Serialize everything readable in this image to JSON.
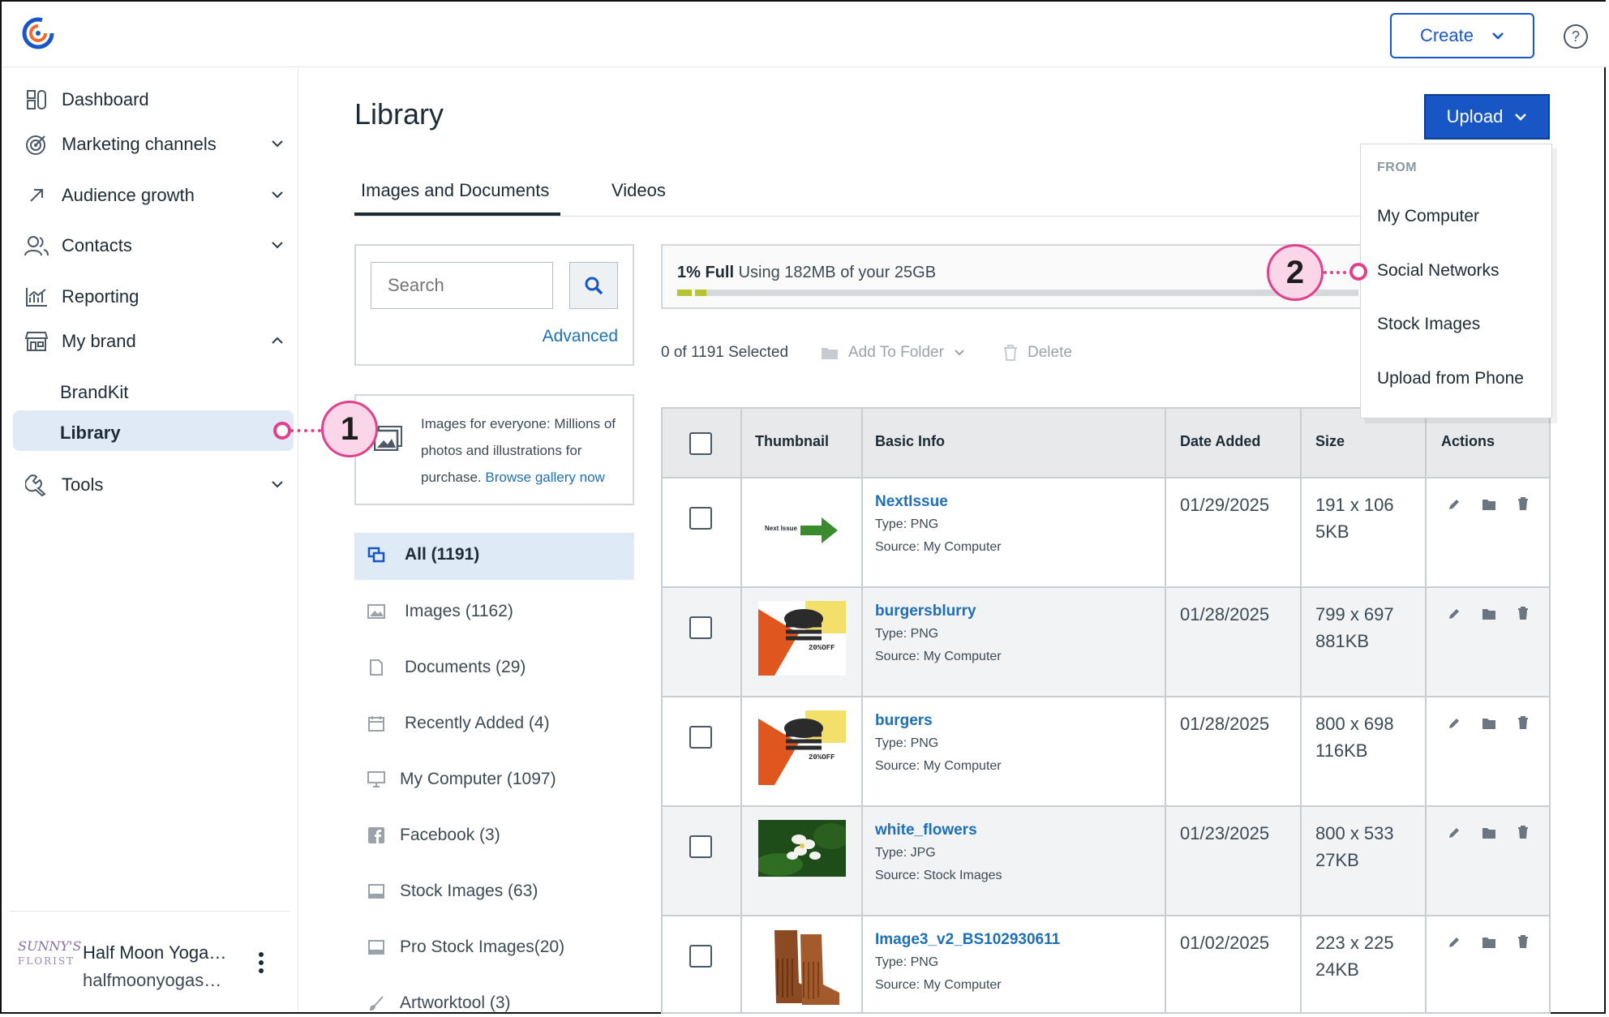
{
  "header": {
    "create_label": "Create",
    "help_glyph": "?"
  },
  "sidebar": {
    "items": [
      {
        "label": "Dashboard",
        "icon": "dashboard-icon"
      },
      {
        "label": "Marketing channels",
        "icon": "target-icon"
      },
      {
        "label": "Audience growth",
        "icon": "arrow-up-right-icon"
      },
      {
        "label": "Contacts",
        "icon": "contacts-icon"
      },
      {
        "label": "Reporting",
        "icon": "chart-icon"
      },
      {
        "label": "My brand",
        "icon": "store-icon"
      },
      {
        "label": "Tools",
        "icon": "wrench-icon"
      }
    ],
    "sub_items": [
      "BrandKit",
      "Library"
    ],
    "account": {
      "name": "Half Moon Yoga…",
      "email": "halfmoonyogas…",
      "logo_line1": "SUNNY'S",
      "logo_line2": "FLORIST"
    }
  },
  "main": {
    "title": "Library",
    "upload_label": "Upload",
    "tabs": [
      "Images and Documents",
      "Videos"
    ],
    "search": {
      "placeholder": "Search",
      "advanced_label": "Advanced"
    },
    "promo": {
      "text": "Images for everyone: Millions of photos and illustrations for purchase.",
      "link": "Browse gallery now"
    },
    "filters": [
      "All (1191)",
      "Images (1162)",
      "Documents (29)",
      "Recently Added (4)",
      "My Computer (1097)",
      "Facebook (3)",
      "Stock Images (63)",
      "Pro Stock Images(20)",
      "Artworktool (3)"
    ],
    "storage": {
      "percent_label": "1% Full",
      "usage_text": "Using 182MB of your 25GB",
      "fill_fraction": 0.01
    },
    "toolbar": {
      "selected": "0 of 1191 Selected",
      "add_to_folder": "Add To Folder",
      "delete": "Delete"
    },
    "table": {
      "headers": [
        "Thumbnail",
        "Basic Info",
        "Date Added",
        "Size",
        "Actions"
      ],
      "rows": [
        {
          "name": "NextIssue",
          "type": "Type: PNG",
          "source": "Source: My Computer",
          "date": "01/29/2025",
          "dims": "191 x 106",
          "size": "5KB",
          "thumb_text": "Next Issue"
        },
        {
          "name": "burgersblurry",
          "type": "Type: PNG",
          "source": "Source: My Computer",
          "date": "01/28/2025",
          "dims": "799 x 697",
          "size": "881KB",
          "thumb_text": "20%OFF"
        },
        {
          "name": "burgers",
          "type": "Type: PNG",
          "source": "Source: My Computer",
          "date": "01/28/2025",
          "dims": "800 x 698",
          "size": "116KB",
          "thumb_text": "20%OFF"
        },
        {
          "name": "white_flowers",
          "type": "Type: JPG",
          "source": "Source: Stock Images",
          "date": "01/23/2025",
          "dims": "800 x 533",
          "size": "27KB",
          "thumb_text": ""
        },
        {
          "name": "Image3_v2_BS102930611",
          "type": "Type: PNG",
          "source": "Source: My Computer",
          "date": "01/02/2025",
          "dims": "223 x 225",
          "size": "24KB",
          "thumb_text": ""
        }
      ]
    },
    "upload_menu": {
      "heading": "FROM",
      "items": [
        "My Computer",
        "Social Networks",
        "Stock Images",
        "Upload from Phone"
      ]
    }
  },
  "callouts": [
    "1",
    "2"
  ],
  "colors": {
    "accent": "#1856c6",
    "link": "#1f6fb7",
    "callout": "#e0408c",
    "active_bg": "#dfeaf6"
  }
}
